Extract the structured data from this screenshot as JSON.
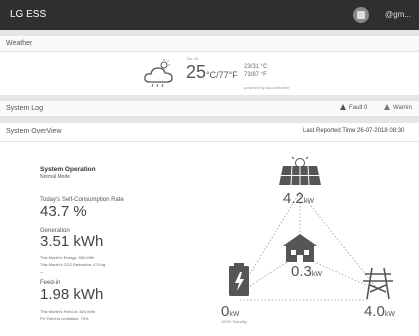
{
  "app": {
    "title": "LG ESS",
    "user": "@gm..."
  },
  "weather": {
    "section_label": "Weather",
    "date": "Dx. HL",
    "temp_main": "25",
    "temp_main_unit": "°C/77°F",
    "hilo_c": "23/31 °C",
    "hilo_f": "73/87 °F",
    "powered_by": "powered by AccuWeather"
  },
  "system_log": {
    "section_label": "System Log",
    "fault": "Fault 0",
    "warning": "Warnin"
  },
  "overview": {
    "section_label": "System OverView",
    "last_reported": "Last Reported Time 26-07-2018 08:30",
    "operation_label": "System Operation",
    "operation_mode": "Normal Mode",
    "self_consumption_label": "Today's Self-Consumption Rate",
    "self_consumption_value": "43.7 %",
    "generation_label": "Generation",
    "generation_value": "3.51 kWh",
    "month_energy": "This Month's Energy: 550 kWh",
    "month_co2": "This Month's CO2 Reduction: 474 kg",
    "sep": "–",
    "feedin_label": "Feed-in",
    "feedin_value": "1.98 kWh",
    "month_feedin": "This Month's Feed-in: 824 kWh",
    "pv_limit": "PV Feed-in Limitation: 70%"
  },
  "diagram": {
    "pv": {
      "value": "4.2",
      "unit": "kW"
    },
    "home": {
      "value": "0.3",
      "unit": "kW"
    },
    "battery": {
      "value": "0",
      "unit": "kW",
      "status": "100% Standby"
    },
    "grid": {
      "value": "4.0",
      "unit": "kW"
    },
    "colors": {
      "icon": "#555555",
      "line": "#9a9a9a",
      "topbar": "#2f2f2f"
    }
  }
}
